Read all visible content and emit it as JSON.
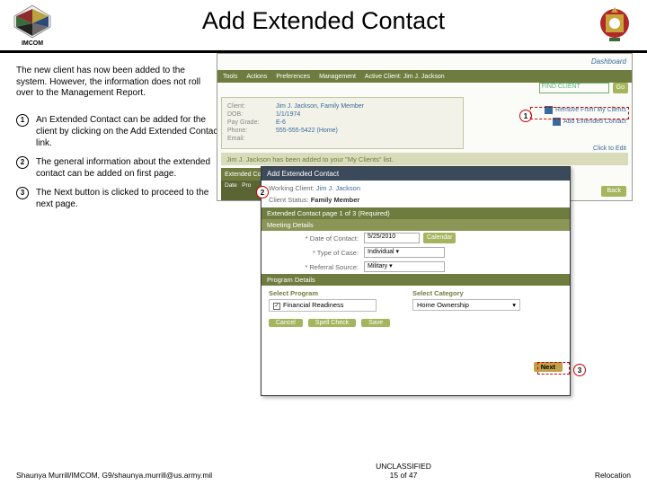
{
  "header": {
    "title": "Add Extended Contact",
    "left_logo_label": "IMCOM"
  },
  "intro": "The new client has now been added to the system. However, the information does not roll over to the Management Report.",
  "steps": [
    "An Extended Contact can be added for the client by clicking on the Add Extended Contact link.",
    "The general information about the extended contact can be added on first page.",
    "The Next button is clicked to proceed to the next page."
  ],
  "mainshot": {
    "dashboard": "Dashboard",
    "tabs": [
      "Tools",
      "Actions",
      "Preferences",
      "Management",
      "Active Client: Jim J. Jackson"
    ],
    "find_placeholder": "FIND CLIENT",
    "go": "Go",
    "client": {
      "rows": [
        {
          "lbl": "Client:",
          "val": "Jim J. Jackson, Family Member"
        },
        {
          "lbl": "DOB:",
          "val": "1/1/1974"
        },
        {
          "lbl": "Pay Grade:",
          "val": "E-6"
        },
        {
          "lbl": "Phone:",
          "val": "555-555-5422 (Home)"
        },
        {
          "lbl": "Email:",
          "val": ""
        }
      ]
    },
    "side": {
      "remove": "Remove From My Clients",
      "add_ext": "Add Extended Contact",
      "click_edit": "Click to Edit"
    },
    "added_msg": "Jim J. Jackson has been added to your \"My Clients\" list.",
    "ext_hdr": "Extended Cont",
    "sub1": "Date",
    "sub2": "Pro",
    "back": "Back"
  },
  "popup": {
    "title": "Add Extended Contact",
    "working_lbl": "Working Client:",
    "working_val": "Jim J. Jackson",
    "status_lbl": "Client Status:",
    "status_val": "Family Member",
    "page_hdr": "Extended Contact page 1 of 3 (Required)",
    "meeting_hdr": "Meeting Details",
    "date_lbl": "* Date of Contact:",
    "date_val": "5/25/2010",
    "calendar": "Calendar",
    "type_lbl": "* Type of Case:",
    "type_val": "Individual",
    "ref_lbl": "* Referral Source:",
    "ref_val": "Military",
    "prog_hdr": "Program Details",
    "sel_prog": "Select Program",
    "prog_item": "Financial Readiness",
    "sel_cat": "Select Category",
    "cat_item": "Home Ownership",
    "cancel": "Cancel",
    "spell": "Spell Check",
    "save": "Save",
    "next": "Next"
  },
  "footer": {
    "left": "Shaunya Murrill/IMCOM, G9/shaunya.murrill@us.army.mil",
    "center_top": "UNCLASSIFIED",
    "center_bottom": "15 of 47",
    "right": "Relocation"
  }
}
